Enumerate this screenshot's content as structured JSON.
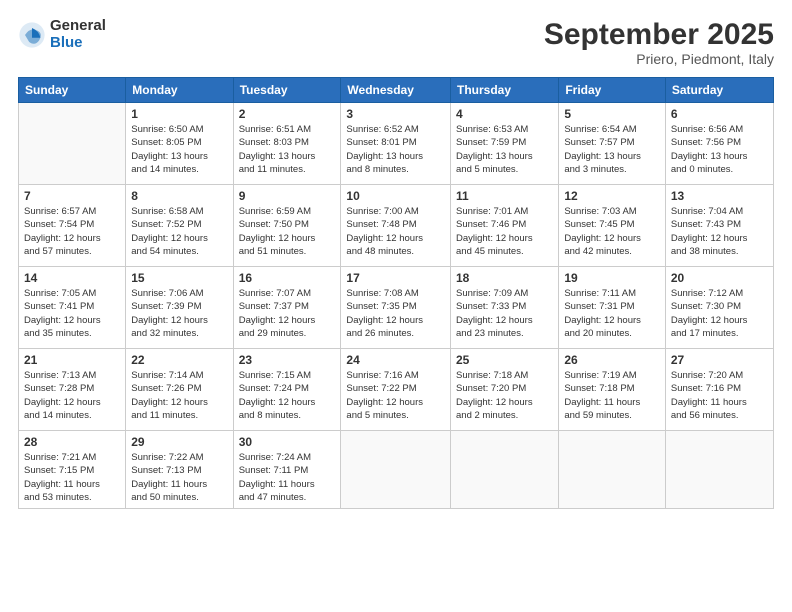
{
  "logo": {
    "general": "General",
    "blue": "Blue"
  },
  "title": "September 2025",
  "subtitle": "Priero, Piedmont, Italy",
  "days_header": [
    "Sunday",
    "Monday",
    "Tuesday",
    "Wednesday",
    "Thursday",
    "Friday",
    "Saturday"
  ],
  "weeks": [
    [
      {
        "day": "",
        "info": ""
      },
      {
        "day": "1",
        "info": "Sunrise: 6:50 AM\nSunset: 8:05 PM\nDaylight: 13 hours\nand 14 minutes."
      },
      {
        "day": "2",
        "info": "Sunrise: 6:51 AM\nSunset: 8:03 PM\nDaylight: 13 hours\nand 11 minutes."
      },
      {
        "day": "3",
        "info": "Sunrise: 6:52 AM\nSunset: 8:01 PM\nDaylight: 13 hours\nand 8 minutes."
      },
      {
        "day": "4",
        "info": "Sunrise: 6:53 AM\nSunset: 7:59 PM\nDaylight: 13 hours\nand 5 minutes."
      },
      {
        "day": "5",
        "info": "Sunrise: 6:54 AM\nSunset: 7:57 PM\nDaylight: 13 hours\nand 3 minutes."
      },
      {
        "day": "6",
        "info": "Sunrise: 6:56 AM\nSunset: 7:56 PM\nDaylight: 13 hours\nand 0 minutes."
      }
    ],
    [
      {
        "day": "7",
        "info": "Sunrise: 6:57 AM\nSunset: 7:54 PM\nDaylight: 12 hours\nand 57 minutes."
      },
      {
        "day": "8",
        "info": "Sunrise: 6:58 AM\nSunset: 7:52 PM\nDaylight: 12 hours\nand 54 minutes."
      },
      {
        "day": "9",
        "info": "Sunrise: 6:59 AM\nSunset: 7:50 PM\nDaylight: 12 hours\nand 51 minutes."
      },
      {
        "day": "10",
        "info": "Sunrise: 7:00 AM\nSunset: 7:48 PM\nDaylight: 12 hours\nand 48 minutes."
      },
      {
        "day": "11",
        "info": "Sunrise: 7:01 AM\nSunset: 7:46 PM\nDaylight: 12 hours\nand 45 minutes."
      },
      {
        "day": "12",
        "info": "Sunrise: 7:03 AM\nSunset: 7:45 PM\nDaylight: 12 hours\nand 42 minutes."
      },
      {
        "day": "13",
        "info": "Sunrise: 7:04 AM\nSunset: 7:43 PM\nDaylight: 12 hours\nand 38 minutes."
      }
    ],
    [
      {
        "day": "14",
        "info": "Sunrise: 7:05 AM\nSunset: 7:41 PM\nDaylight: 12 hours\nand 35 minutes."
      },
      {
        "day": "15",
        "info": "Sunrise: 7:06 AM\nSunset: 7:39 PM\nDaylight: 12 hours\nand 32 minutes."
      },
      {
        "day": "16",
        "info": "Sunrise: 7:07 AM\nSunset: 7:37 PM\nDaylight: 12 hours\nand 29 minutes."
      },
      {
        "day": "17",
        "info": "Sunrise: 7:08 AM\nSunset: 7:35 PM\nDaylight: 12 hours\nand 26 minutes."
      },
      {
        "day": "18",
        "info": "Sunrise: 7:09 AM\nSunset: 7:33 PM\nDaylight: 12 hours\nand 23 minutes."
      },
      {
        "day": "19",
        "info": "Sunrise: 7:11 AM\nSunset: 7:31 PM\nDaylight: 12 hours\nand 20 minutes."
      },
      {
        "day": "20",
        "info": "Sunrise: 7:12 AM\nSunset: 7:30 PM\nDaylight: 12 hours\nand 17 minutes."
      }
    ],
    [
      {
        "day": "21",
        "info": "Sunrise: 7:13 AM\nSunset: 7:28 PM\nDaylight: 12 hours\nand 14 minutes."
      },
      {
        "day": "22",
        "info": "Sunrise: 7:14 AM\nSunset: 7:26 PM\nDaylight: 12 hours\nand 11 minutes."
      },
      {
        "day": "23",
        "info": "Sunrise: 7:15 AM\nSunset: 7:24 PM\nDaylight: 12 hours\nand 8 minutes."
      },
      {
        "day": "24",
        "info": "Sunrise: 7:16 AM\nSunset: 7:22 PM\nDaylight: 12 hours\nand 5 minutes."
      },
      {
        "day": "25",
        "info": "Sunrise: 7:18 AM\nSunset: 7:20 PM\nDaylight: 12 hours\nand 2 minutes."
      },
      {
        "day": "26",
        "info": "Sunrise: 7:19 AM\nSunset: 7:18 PM\nDaylight: 11 hours\nand 59 minutes."
      },
      {
        "day": "27",
        "info": "Sunrise: 7:20 AM\nSunset: 7:16 PM\nDaylight: 11 hours\nand 56 minutes."
      }
    ],
    [
      {
        "day": "28",
        "info": "Sunrise: 7:21 AM\nSunset: 7:15 PM\nDaylight: 11 hours\nand 53 minutes."
      },
      {
        "day": "29",
        "info": "Sunrise: 7:22 AM\nSunset: 7:13 PM\nDaylight: 11 hours\nand 50 minutes."
      },
      {
        "day": "30",
        "info": "Sunrise: 7:24 AM\nSunset: 7:11 PM\nDaylight: 11 hours\nand 47 minutes."
      },
      {
        "day": "",
        "info": ""
      },
      {
        "day": "",
        "info": ""
      },
      {
        "day": "",
        "info": ""
      },
      {
        "day": "",
        "info": ""
      }
    ]
  ]
}
